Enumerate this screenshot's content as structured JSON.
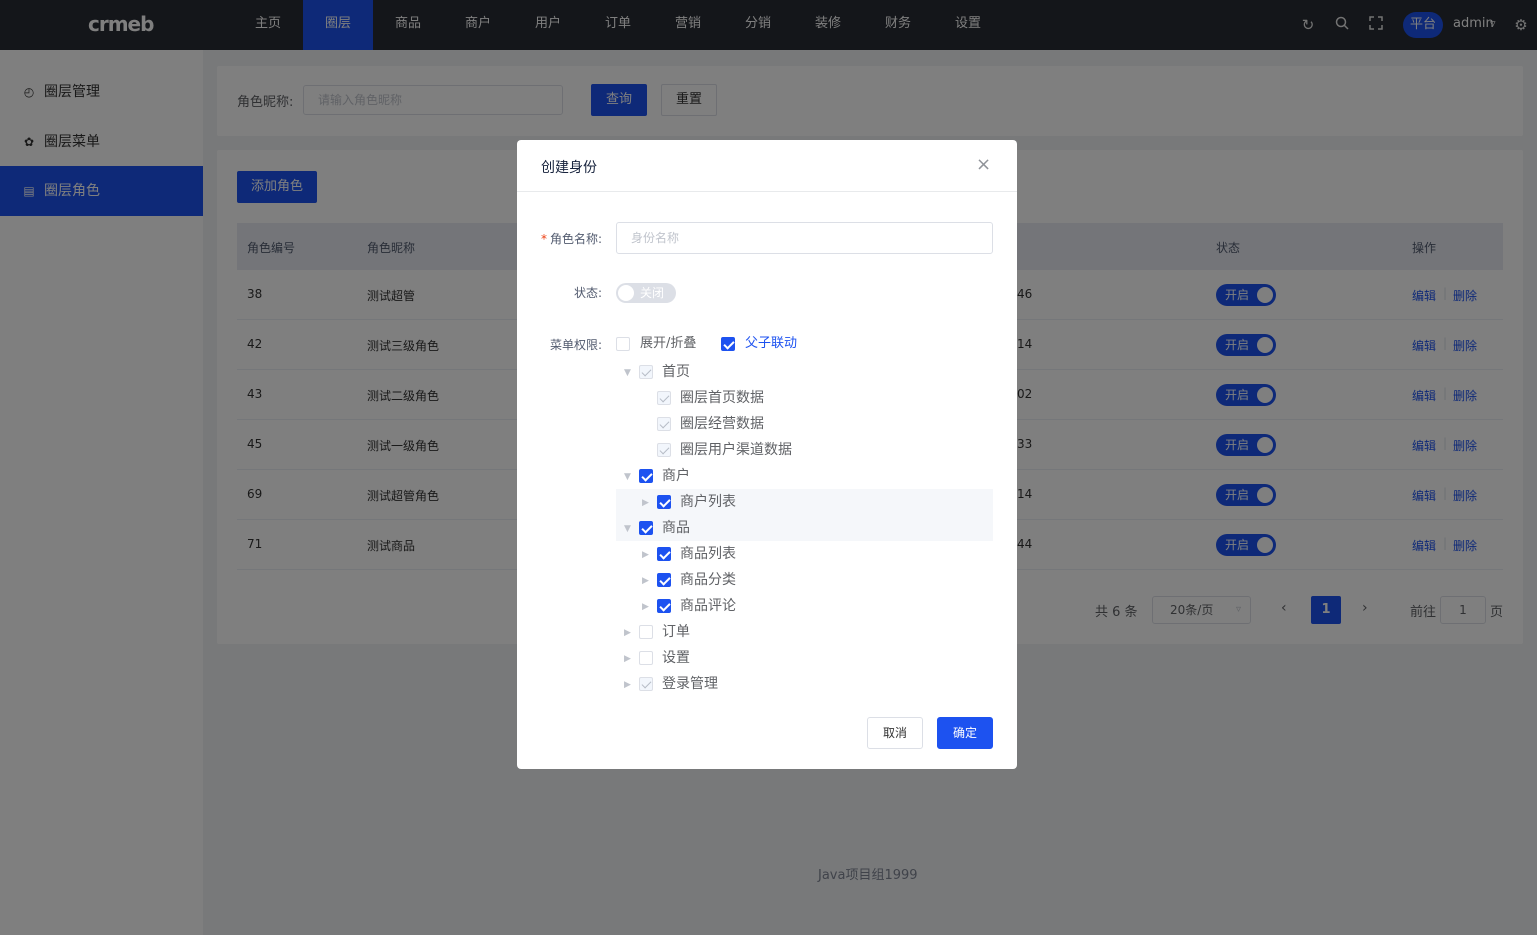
{
  "logo": "crmeb",
  "nav": [
    "主页",
    "圈层",
    "商品",
    "商户",
    "用户",
    "订单",
    "营销",
    "分销",
    "装修",
    "财务",
    "设置"
  ],
  "header": {
    "platform": "平台",
    "user": "admin",
    "icons": [
      "refresh-icon",
      "search-icon",
      "fullscreen-icon",
      "settings-icon"
    ]
  },
  "sidebar": [
    {
      "label": "圈层管理",
      "icon": "compass-icon"
    },
    {
      "label": "圈层菜单",
      "icon": "gear-icon"
    },
    {
      "label": "圈层角色",
      "icon": "document-icon"
    }
  ],
  "search": {
    "label": "角色昵称:",
    "placeholder": "请输入角色昵称",
    "query": "查询",
    "reset": "重置"
  },
  "add_button": "添加角色",
  "table": {
    "headers": [
      "角色编号",
      "角色昵称",
      "状态",
      "操作"
    ],
    "rows": [
      {
        "id": "38",
        "name": "测试超管",
        "time": "46",
        "status": "开启"
      },
      {
        "id": "42",
        "name": "测试三级角色",
        "time": "14",
        "status": "开启"
      },
      {
        "id": "43",
        "name": "测试二级角色",
        "time": "02",
        "status": "开启"
      },
      {
        "id": "45",
        "name": "测试一级角色",
        "time": "33",
        "status": "开启"
      },
      {
        "id": "69",
        "name": "测试超管角色",
        "time": "14",
        "status": "开启"
      },
      {
        "id": "71",
        "name": "测试商品",
        "time": "44",
        "status": "开启"
      }
    ],
    "edit": "编辑",
    "delete": "删除",
    "sep": "|"
  },
  "pagination": {
    "total": "共 6 条",
    "page_size": "20条/页",
    "prev": "‹",
    "next": "›",
    "current": "1",
    "goto_label": "前往",
    "goto_value": "1",
    "page_unit": "页"
  },
  "footer": "Java项目组1999",
  "dialog": {
    "title": "创建身份",
    "close": "×",
    "required_mark": "*",
    "name_label": "角色名称:",
    "name_placeholder": "身份名称",
    "status_label": "状态:",
    "status_value": "关闭",
    "perm_label": "菜单权限:",
    "expand_label": "展开/折叠",
    "link_label": "父子联动",
    "tree": [
      {
        "label": "首页",
        "level": 0,
        "state": "disabled",
        "caret": "down"
      },
      {
        "label": "圈层首页数据",
        "level": 1,
        "state": "disabled",
        "caret": "none"
      },
      {
        "label": "圈层经营数据",
        "level": 1,
        "state": "disabled",
        "caret": "none"
      },
      {
        "label": "圈层用户渠道数据",
        "level": 1,
        "state": "disabled",
        "caret": "none"
      },
      {
        "label": "商户",
        "level": 0,
        "state": "checked",
        "caret": "down"
      },
      {
        "label": "商户列表",
        "level": 1,
        "state": "checked",
        "caret": "right"
      },
      {
        "label": "商品",
        "level": 0,
        "state": "checked",
        "caret": "down"
      },
      {
        "label": "商品列表",
        "level": 1,
        "state": "checked",
        "caret": "right"
      },
      {
        "label": "商品分类",
        "level": 1,
        "state": "checked",
        "caret": "right"
      },
      {
        "label": "商品评论",
        "level": 1,
        "state": "checked",
        "caret": "right"
      },
      {
        "label": "订单",
        "level": 0,
        "state": "unchecked",
        "caret": "right"
      },
      {
        "label": "设置",
        "level": 0,
        "state": "unchecked",
        "caret": "right"
      },
      {
        "label": "登录管理",
        "level": 0,
        "state": "disabled",
        "caret": "right"
      }
    ],
    "cancel": "取消",
    "confirm": "确定"
  },
  "colors": {
    "primary": "#1d52f0",
    "topbar": "#282c34",
    "background": "#f0f2f5"
  }
}
